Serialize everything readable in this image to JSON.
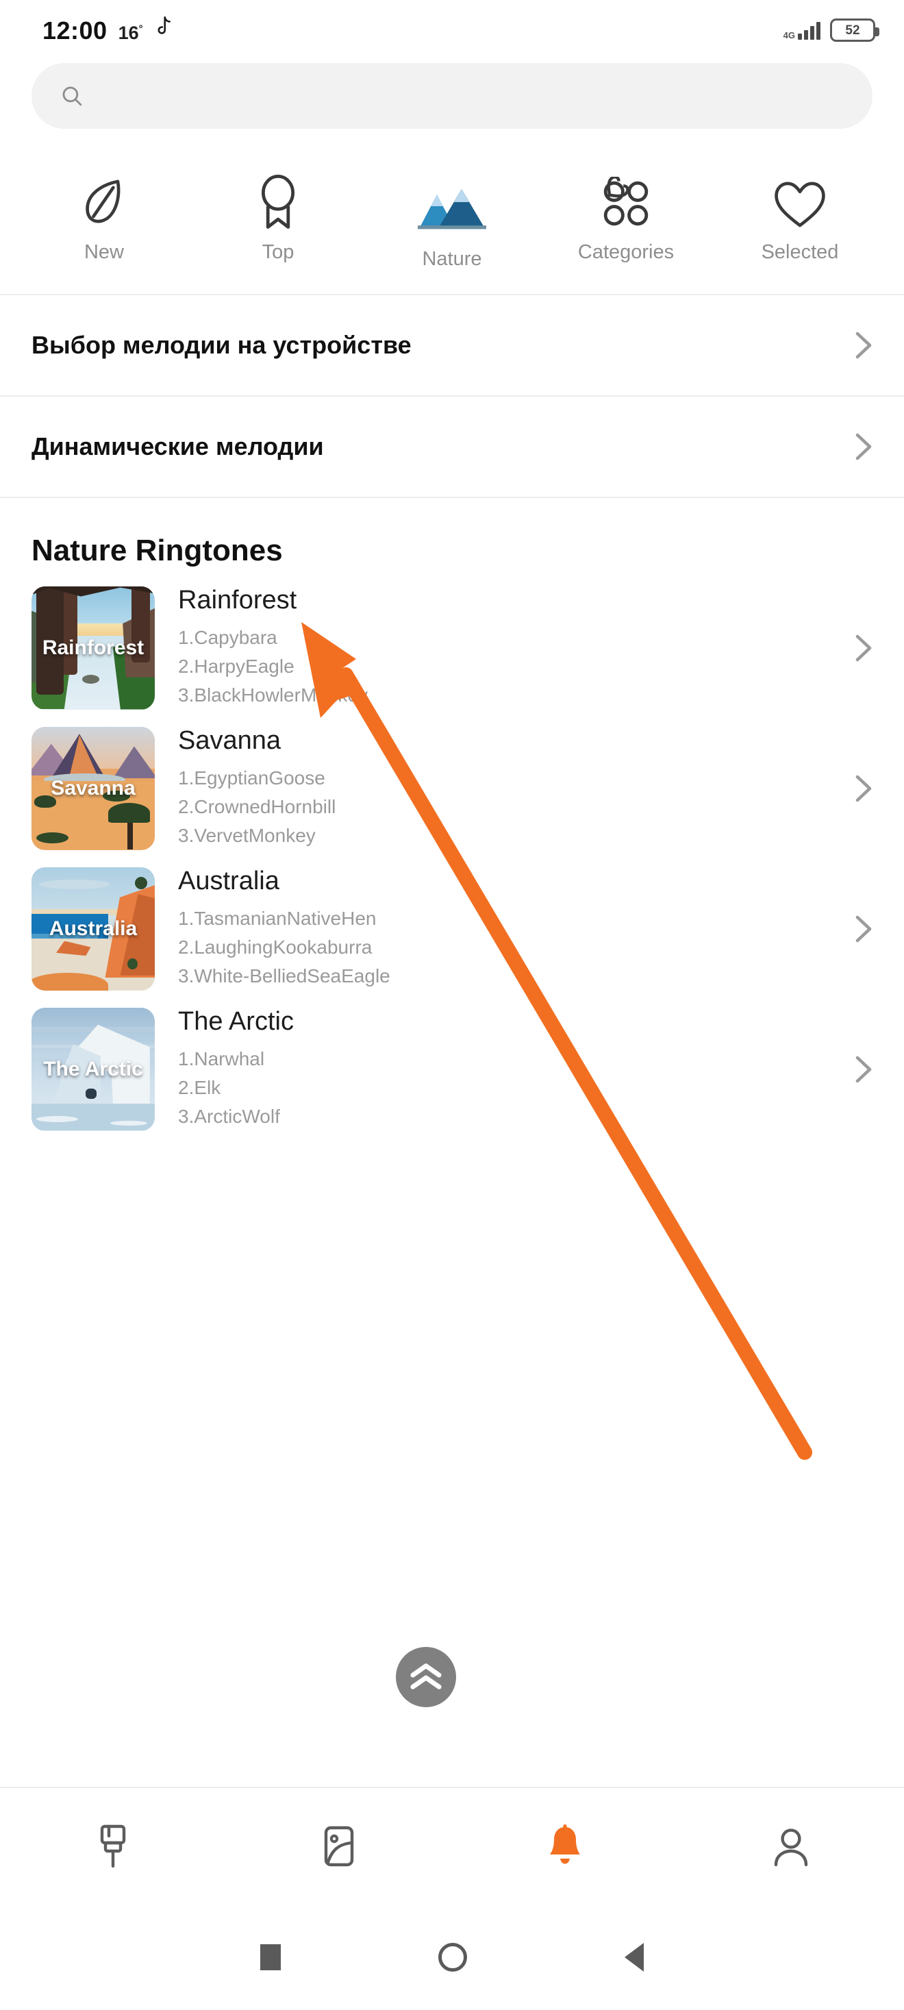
{
  "status_bar": {
    "time": "12:00",
    "temperature": "16",
    "degree": "°",
    "tiktok_icon": "tiktok-icon",
    "network": "4G",
    "battery_level": "52"
  },
  "search": {
    "placeholder": "",
    "value": "",
    "icon": "search-icon"
  },
  "tabs": [
    {
      "label": "New",
      "icon": "leaf-icon",
      "active": false
    },
    {
      "label": "Top",
      "icon": "award-icon",
      "active": false
    },
    {
      "label": "Nature",
      "icon": "mountains-icon",
      "active": true
    },
    {
      "label": "Categories",
      "icon": "grid-icon",
      "active": false
    },
    {
      "label": "Selected",
      "icon": "heart-icon",
      "active": false
    }
  ],
  "setting_rows": [
    {
      "label": "Выбор мелодии на устройстве",
      "chevron": "chevron-right-icon"
    },
    {
      "label": "Динамические мелодии",
      "chevron": "chevron-right-icon"
    }
  ],
  "section": {
    "title": "Nature Ringtones"
  },
  "ringtones": [
    {
      "title": "Rainforest",
      "thumb_label": "Rainforest",
      "items": [
        "1.Capybara",
        "2.HarpyEagle",
        "3.BlackHowlerMonkey"
      ]
    },
    {
      "title": "Savanna",
      "thumb_label": "Savanna",
      "items": [
        "1.EgyptianGoose",
        "2.CrownedHornbill",
        "3.VervetMonkey"
      ]
    },
    {
      "title": "Australia",
      "thumb_label": "Australia",
      "items": [
        "1.TasmanianNativeHen",
        "2.LaughingKookaburra",
        "3.White-BelliedSeaEagle"
      ]
    },
    {
      "title": "The Arctic",
      "thumb_label": "The Arctic",
      "items": [
        "1.Narwhal",
        "2.Elk",
        "3.ArcticWolf"
      ]
    }
  ],
  "scroll_top_button": {
    "icon": "double-chevron-up-icon"
  },
  "bottom_nav": [
    {
      "icon": "wallpaper-roller-icon",
      "active": false
    },
    {
      "icon": "image-icon",
      "active": false
    },
    {
      "icon": "bell-icon",
      "active": true
    },
    {
      "icon": "person-icon",
      "active": false
    }
  ],
  "android_nav": [
    {
      "icon": "recents-square-icon"
    },
    {
      "icon": "home-circle-icon"
    },
    {
      "icon": "back-triangle-icon"
    }
  ],
  "annotation": {
    "arrow_color": "#f26f21"
  },
  "colors": {
    "accent": "#f26f21",
    "nature_light": "#2d8cc0",
    "nature_dark": "#1d5f8a",
    "nature_snow": "#b8d9ef",
    "muted_text": "#9a9a9a",
    "fab_bg": "#808080"
  }
}
